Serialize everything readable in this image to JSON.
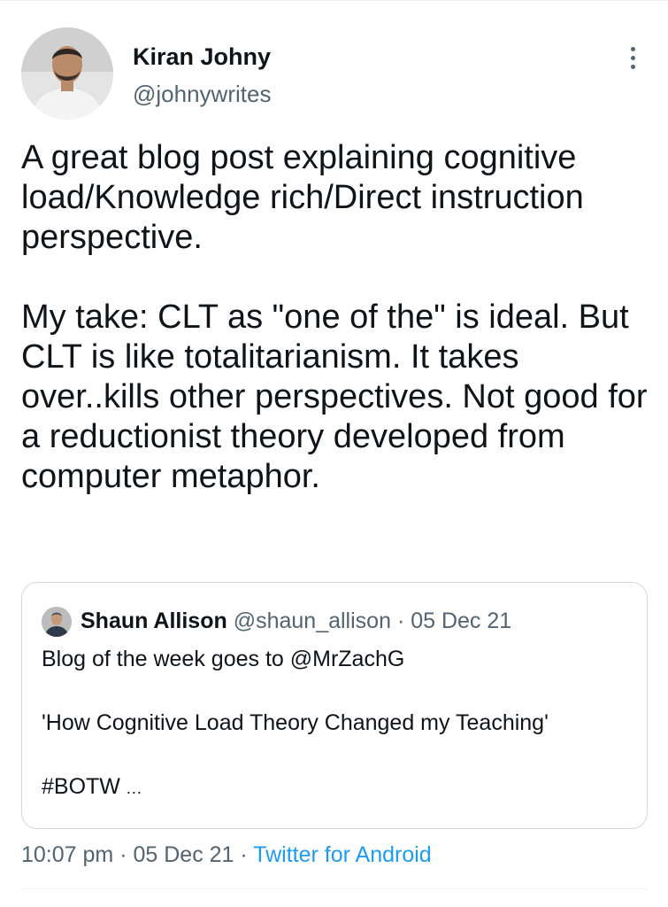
{
  "author": {
    "name": "Kiran Johny",
    "handle": "@johnywrites",
    "avatar_icon": "profile-photo"
  },
  "tweet": {
    "text": "A great blog post explaining cognitive load/Knowledge rich/Direct instruction perspective.\n\nMy take: CLT as \"one of the\" is ideal. But CLT is like totalitarianism. It takes over..kills other perspectives. Not good for a reductionist theory developed from computer metaphor."
  },
  "quoted_tweet": {
    "author_name": "Shaun Allison",
    "author_handle": "@shaun_allison",
    "separator": "·",
    "date": "05 Dec 21",
    "lines": [
      "Blog of the week goes to @MrZachG",
      "'How Cognitive Load Theory Changed my Teaching'",
      "#BOTW"
    ],
    "ellipsis": "..."
  },
  "meta": {
    "time": "10:07 pm",
    "separator": "·",
    "date": "05 Dec 21",
    "source": "Twitter for Android"
  },
  "colors": {
    "text": "#0f1419",
    "secondary": "#536471",
    "link": "#1d9bf0",
    "border": "#cfd9de"
  }
}
